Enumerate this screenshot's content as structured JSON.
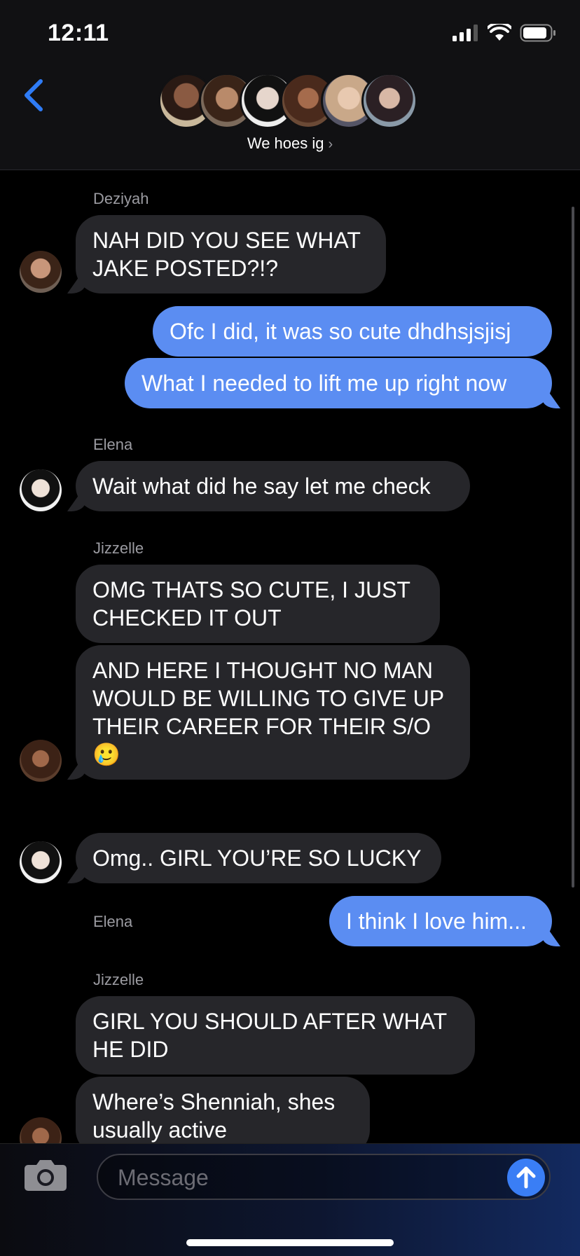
{
  "status_bar": {
    "time": "12:11"
  },
  "header": {
    "group_name": "We hoes ig",
    "chevron": "›"
  },
  "messages": [
    {
      "sender": "Deziyah",
      "text": "NAH DID YOU SEE WHAT JAKE POSTED?!?"
    },
    {
      "text": "Ofc I did, it was so cute dhdhsjsjisj"
    },
    {
      "text": "What I needed to lift me up right now"
    },
    {
      "sender": "Elena",
      "text": "Wait what did he say let me check"
    },
    {
      "sender": "Jizzelle",
      "text": "OMG THATS SO CUTE, I JUST CHECKED IT OUT"
    },
    {
      "text": "AND HERE I THOUGHT NO MAN WOULD BE WILLING TO GIVE UP THEIR CAREER FOR THEIR S/O 🥲"
    },
    {
      "sender": "Elena",
      "text": "Omg.. GIRL YOU’RE SO LUCKY"
    },
    {
      "text": "I think I love him..."
    },
    {
      "sender": "Jizzelle",
      "text": "GIRL YOU SHOULD AFTER WHAT HE DID"
    },
    {
      "text": "Where’s Shenniah, shes usually active"
    }
  ],
  "compose": {
    "placeholder": "Message"
  },
  "colors": {
    "outgoing": "#5b8df2",
    "incoming": "#26262a",
    "accent": "#3a7ef5"
  },
  "icons": [
    "back-chevron-icon",
    "camera-icon",
    "send-arrow-icon",
    "signal-icon",
    "wifi-icon",
    "battery-icon"
  ]
}
